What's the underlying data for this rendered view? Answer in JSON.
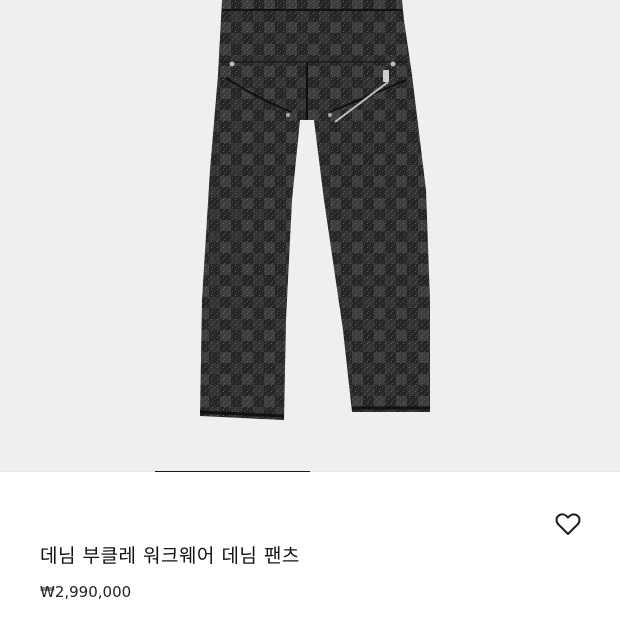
{
  "product": {
    "name": "데님 부클레 워크웨어 데님 팬츠",
    "price": "₩2,990,000",
    "image_icon": "pants-product-photo"
  },
  "gallery": {
    "active_index": 1,
    "count": 4
  },
  "actions": {
    "wishlist_icon": "heart-outline-icon"
  },
  "colors": {
    "image_bg": "#efefef",
    "fabric_dark": "#1c1c1c",
    "fabric_light": "#555555",
    "indicator_active": "#1a1a1a",
    "indicator_track": "#e6e6e6"
  }
}
